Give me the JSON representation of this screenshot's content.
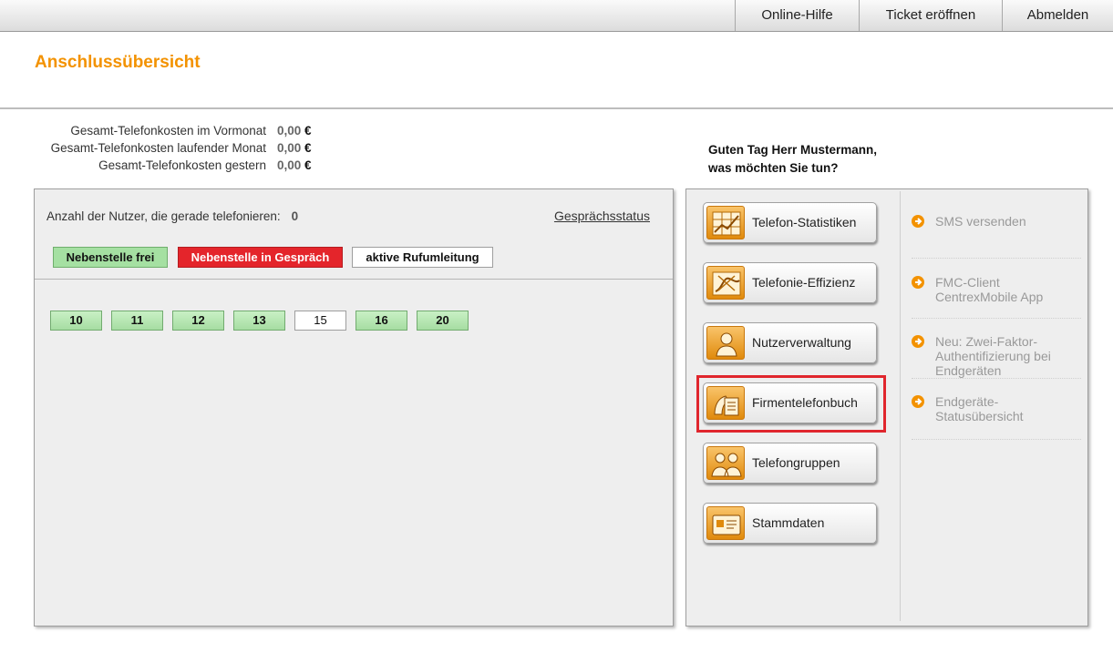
{
  "topnav": {
    "help": "Online-Hilfe",
    "ticket": "Ticket eröffnen",
    "logout": "Abmelden"
  },
  "page_title": "Anschlussübersicht",
  "costs": [
    {
      "label": "Gesamt-Telefonkosten im Vormonat",
      "value": "0,00",
      "currency": "€"
    },
    {
      "label": "Gesamt-Telefonkosten laufender Monat",
      "value": "0,00",
      "currency": "€"
    },
    {
      "label": "Gesamt-Telefonkosten gestern",
      "value": "0,00",
      "currency": "€"
    }
  ],
  "greeting": {
    "line1": "Guten Tag Herr Mustermann,",
    "line2": "was möchten Sie tun?"
  },
  "left_panel": {
    "users_label": "Anzahl der Nutzer, die gerade telefonieren:",
    "users_count": "0",
    "status_link": "Gesprächsstatus",
    "legend": {
      "free": "Nebenstelle frei",
      "busy": "Nebenstelle in Gespräch",
      "forward": "aktive Rufumleitung"
    },
    "extensions": [
      "10",
      "11",
      "12",
      "13",
      "15",
      "16",
      "20"
    ]
  },
  "functions": [
    {
      "label": "Telefon-Statistiken",
      "icon": "statistics-icon"
    },
    {
      "label": "Telefonie-Effizienz",
      "icon": "efficiency-icon"
    },
    {
      "label": "Nutzerverwaltung",
      "icon": "user-icon"
    },
    {
      "label": "Firmentelefonbuch",
      "icon": "phonebook-icon"
    },
    {
      "label": "Telefongruppen",
      "icon": "group-icon"
    },
    {
      "label": "Stammdaten",
      "icon": "master-data-icon"
    }
  ],
  "side_links": [
    {
      "line1": "SMS versenden"
    },
    {
      "line1": "FMC-Client",
      "line2": "CentrexMobile App"
    },
    {
      "line1": "Neu: Zwei-Faktor-",
      "line2": "Authentifizierung bei",
      "line3": "Endgeräten"
    },
    {
      "line1": "Endgeräte-",
      "line2": "Statusübersicht"
    }
  ],
  "colors": {
    "accent": "#f39200",
    "free": "#a5e0a2",
    "busy": "#e4252b",
    "highlight": "#e0262d"
  }
}
